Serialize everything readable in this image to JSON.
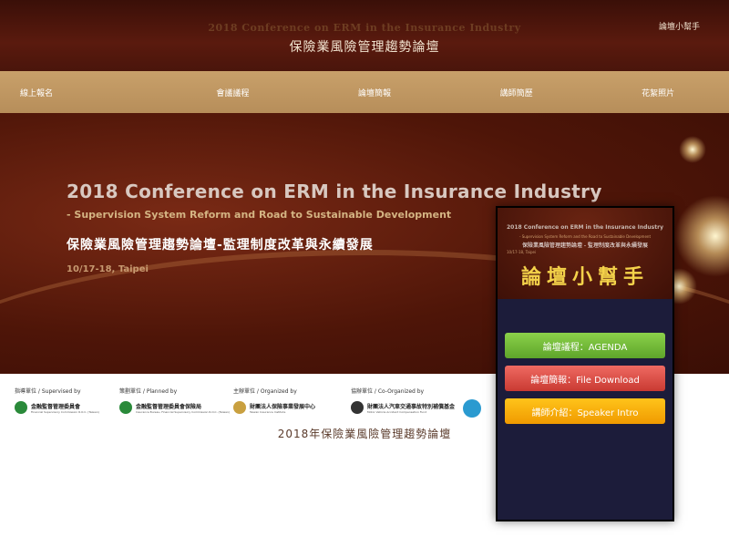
{
  "header": {
    "title_en": "2018 Conference on ERM in the Insurance Industry",
    "title_zh": "保險業風險管理趨勢論壇",
    "helper_link": "論壇小幫手"
  },
  "nav": {
    "items": [
      "線上報名",
      "會議議程",
      "論壇簡報",
      "講師簡歷",
      "花絮照片"
    ]
  },
  "hero": {
    "title": "2018 Conference on ERM in the Insurance Industry",
    "subtitle": "- Supervision System Reform and Road to Sustainable Development",
    "title_zh": "保險業風險管理趨勢論壇-監理制度改革與永續發展",
    "date": "10/17-18, Taipei"
  },
  "sponsors": {
    "groups": [
      {
        "label": "指導單位 / Supervised by",
        "name": "金融監督管理委員會",
        "name_en": "Financial Supervisory Commission R.O.C. (Taiwan)"
      },
      {
        "label": "策劃單位 / Planned by",
        "name": "金融監督管理委員會保險局",
        "name_en": "Insurance Bureau, Financial Supervisory Commission R.O.C. (Taiwan)"
      },
      {
        "label": "主辦單位 / Organized by",
        "name": "財團法人保險事業發展中心",
        "name_en": "Taiwan Insurance Institute"
      },
      {
        "label": "協辦單位 / Co-Organized by",
        "name": "財團法人汽車交通事故特別補償基金",
        "name_en": "Motor Vehicle Accident Compensation Fund"
      }
    ],
    "footer": "2018年保險業風險管理趨勢論壇"
  },
  "phone": {
    "banner_en": "2018 Conference on ERM in the Insurance Industry",
    "banner_sub": "- Supervision System Reform and the Road to Sustainable Development",
    "banner_zh": "保險業風險管理趨勢論壇 - 監理制度改革與永續發展",
    "banner_date": "10/17-18, Taipei",
    "title": "論壇小幫手",
    "buttons": {
      "agenda": "論壇議程：AGENDA",
      "download": "論壇簡報：File Download",
      "speaker": "講師介紹：Speaker Intro"
    }
  },
  "colors": {
    "header_bg": "#4a150b",
    "nav_bg": "#c8a06a",
    "phone_bg": "#1c1c3a",
    "accent_yellow": "#f4d24a",
    "btn_green": "#6cb934",
    "btn_red": "#e05048",
    "btn_orange": "#ffb00a"
  }
}
